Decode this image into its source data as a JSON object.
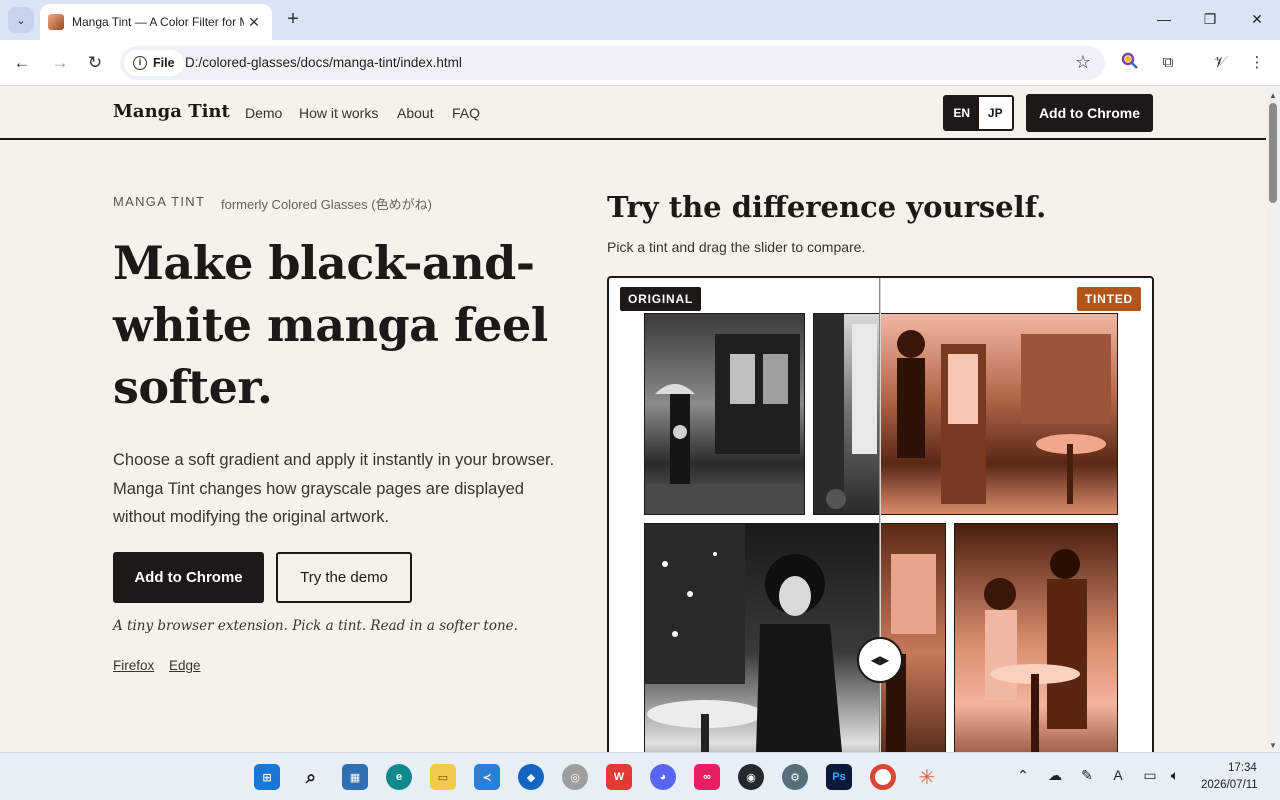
{
  "browser": {
    "tab_title": "Manga Tint — A Color Filter for Manga",
    "tab_close": "✕",
    "new_tab": "+",
    "site_chip": "File",
    "url": "D:/colored-glasses/docs/manga-tint/index.html"
  },
  "header": {
    "brand": "Manga Tint",
    "nav": [
      "Demo",
      "How it works",
      "About",
      "FAQ"
    ],
    "lang": [
      "EN",
      "JP"
    ],
    "active_lang": "EN",
    "cta": "Add to Chrome"
  },
  "hero": {
    "eyebrow": "MANGA TINT",
    "eyebrow_sub": "formerly Colored Glasses (色めがね)",
    "title": "Make black-and-white manga feel softer.",
    "body": "Choose a soft gradient and apply it instantly in your browser. Manga Tint changes how grayscale pages are displayed without modifying the original artwork.",
    "primary_button": "Add to Chrome",
    "secondary_button": "Try the demo",
    "tagline": "A tiny browser extension. Pick a tint. Read in a softer tone.",
    "alt_links": [
      "Firefox",
      "Edge"
    ]
  },
  "demo": {
    "title": "Try the difference yourself.",
    "subtitle": "Pick a tint and drag the slider to compare.",
    "badge_original": "ORIGINAL",
    "badge_tinted": "TINTED",
    "slider_position": 0.5
  },
  "taskbar": {
    "time": "17:34",
    "date": "2026/07/11"
  },
  "colors": {
    "ink": "#1c1916",
    "page_bg": "#f6f2eb",
    "tint_accent": "#b0561c"
  }
}
